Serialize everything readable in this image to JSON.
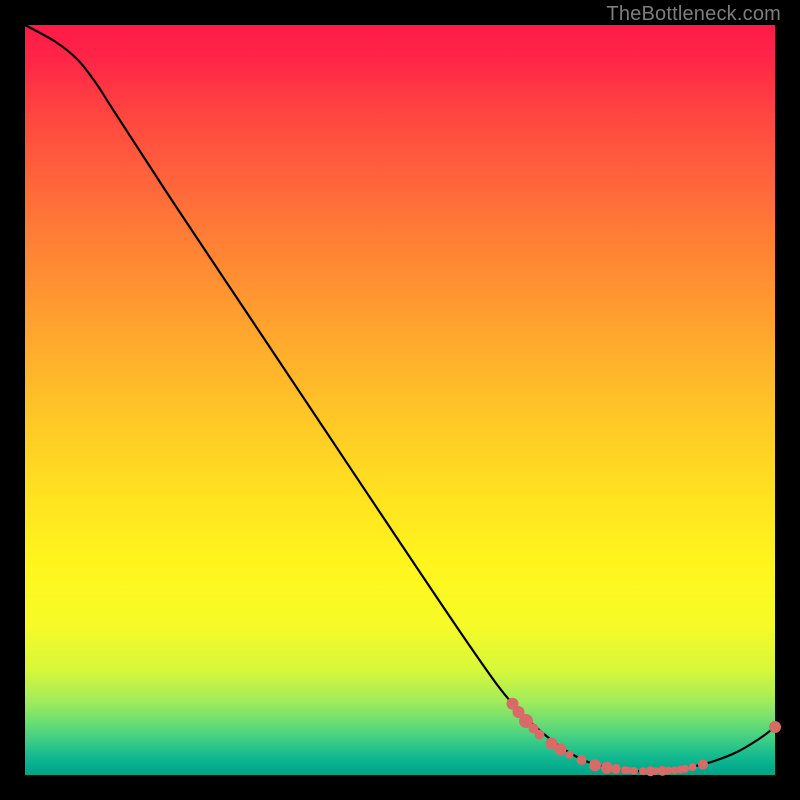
{
  "watermark": "TheBottleneck.com",
  "chart_data": {
    "type": "line",
    "title": "",
    "xlabel": "",
    "ylabel": "",
    "xlim": [
      0,
      100
    ],
    "ylim": [
      0,
      100
    ],
    "curve": [
      {
        "x": 0,
        "y": 100
      },
      {
        "x": 4,
        "y": 97.8
      },
      {
        "x": 7,
        "y": 95.4
      },
      {
        "x": 9.5,
        "y": 92.2
      },
      {
        "x": 12,
        "y": 88.3
      },
      {
        "x": 20,
        "y": 76.0
      },
      {
        "x": 30,
        "y": 61.0
      },
      {
        "x": 40,
        "y": 46.0
      },
      {
        "x": 50,
        "y": 31.0
      },
      {
        "x": 60,
        "y": 16.2
      },
      {
        "x": 65,
        "y": 9.5
      },
      {
        "x": 70,
        "y": 4.8
      },
      {
        "x": 74,
        "y": 2.2
      },
      {
        "x": 78,
        "y": 0.9
      },
      {
        "x": 82,
        "y": 0.5
      },
      {
        "x": 86,
        "y": 0.6
      },
      {
        "x": 89,
        "y": 1.1
      },
      {
        "x": 92,
        "y": 1.9
      },
      {
        "x": 95,
        "y": 3.1
      },
      {
        "x": 98,
        "y": 4.9
      },
      {
        "x": 100,
        "y": 6.4
      }
    ],
    "markers": [
      {
        "x": 65.0,
        "y": 9.5,
        "r": 6
      },
      {
        "x": 65.8,
        "y": 8.4,
        "r": 6
      },
      {
        "x": 66.8,
        "y": 7.2,
        "r": 7
      },
      {
        "x": 67.8,
        "y": 6.2,
        "r": 5
      },
      {
        "x": 68.6,
        "y": 5.4,
        "r": 5
      },
      {
        "x": 70.2,
        "y": 4.2,
        "r": 6
      },
      {
        "x": 71.4,
        "y": 3.4,
        "r": 6
      },
      {
        "x": 72.6,
        "y": 2.7,
        "r": 4
      },
      {
        "x": 74.2,
        "y": 2.0,
        "r": 5
      },
      {
        "x": 76.0,
        "y": 1.3,
        "r": 6
      },
      {
        "x": 77.6,
        "y": 0.95,
        "r": 6
      },
      {
        "x": 78.8,
        "y": 0.8,
        "r": 5
      },
      {
        "x": 80.0,
        "y": 0.65,
        "r": 4
      },
      {
        "x": 80.5,
        "y": 0.6,
        "r": 3.5
      },
      {
        "x": 81.2,
        "y": 0.55,
        "r": 4
      },
      {
        "x": 82.4,
        "y": 0.5,
        "r": 4
      },
      {
        "x": 83.4,
        "y": 0.5,
        "r": 5
      },
      {
        "x": 84.0,
        "y": 0.52,
        "r": 4
      },
      {
        "x": 85.0,
        "y": 0.55,
        "r": 5
      },
      {
        "x": 85.8,
        "y": 0.58,
        "r": 4
      },
      {
        "x": 86.6,
        "y": 0.62,
        "r": 4
      },
      {
        "x": 87.4,
        "y": 0.72,
        "r": 4
      },
      {
        "x": 88.0,
        "y": 0.82,
        "r": 4
      },
      {
        "x": 89.0,
        "y": 1.05,
        "r": 4
      },
      {
        "x": 90.4,
        "y": 1.4,
        "r": 5
      },
      {
        "x": 100.0,
        "y": 6.4,
        "r": 6
      }
    ]
  }
}
